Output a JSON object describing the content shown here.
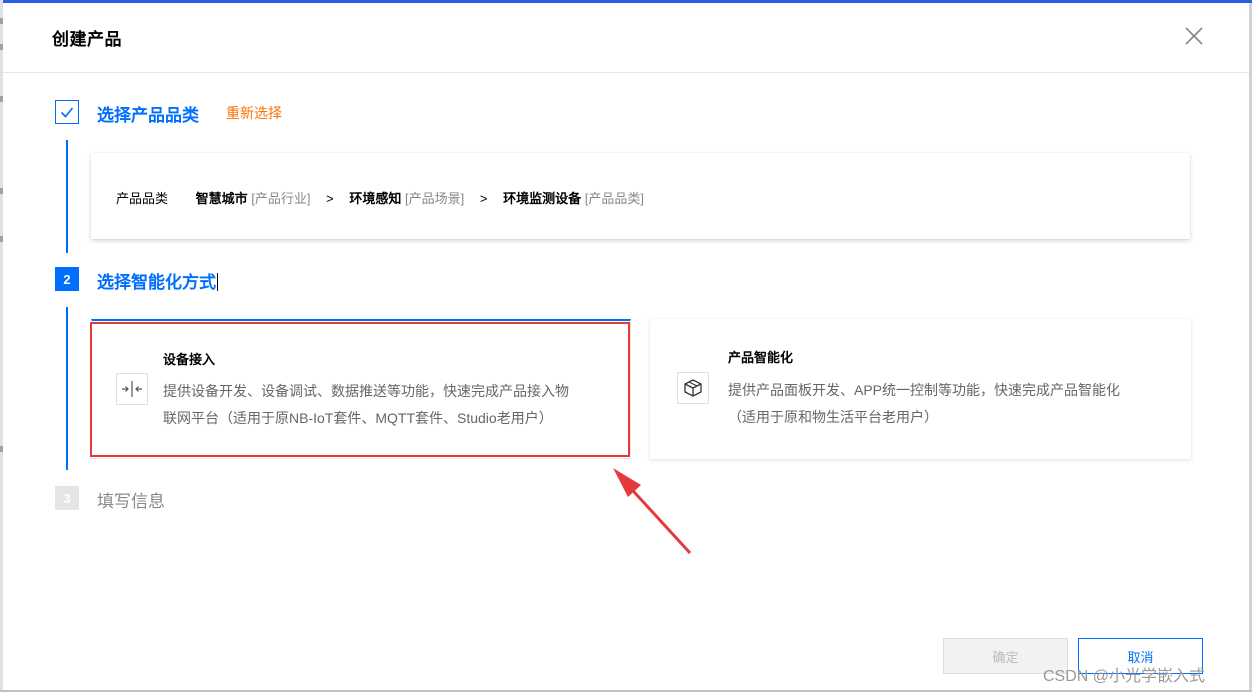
{
  "dialog": {
    "title": "创建产品"
  },
  "steps": [
    {
      "number": "",
      "title": "选择产品品类",
      "action": "重新选择",
      "state": "completed"
    },
    {
      "number": "2",
      "title": "选择智能化方式",
      "state": "active"
    },
    {
      "number": "3",
      "title": "填写信息",
      "state": "pending"
    }
  ],
  "category": {
    "label": "产品品类",
    "path": [
      {
        "name": "智慧城市",
        "tag": "[产品行业]"
      },
      {
        "name": "环境感知",
        "tag": "[产品场景]"
      },
      {
        "name": "环境监测设备",
        "tag": "[产品品类]"
      }
    ],
    "separator": ">"
  },
  "options": [
    {
      "title": "设备接入",
      "icon": "device-connect-icon",
      "desc_line1": "提供设备开发、设备调试、数据推送等功能，快速完成产品接入物",
      "desc_line2": "联网平台（适用于原NB-IoT套件、MQTT套件、Studio老用户）",
      "highlighted": true
    },
    {
      "title": "产品智能化",
      "icon": "cube-icon",
      "desc_line1": "提供产品面板开发、APP统一控制等功能，快速完成产品智能化",
      "desc_line2": "（适用于原和物生活平台老用户）",
      "highlighted": false
    }
  ],
  "footer": {
    "confirm_label": "确定",
    "cancel_label": "取消"
  },
  "watermark": "CSDN @小光学嵌入式",
  "colors": {
    "accent": "#006eff",
    "reselect": "#ff7200",
    "highlight_border": "#e53a3a"
  }
}
